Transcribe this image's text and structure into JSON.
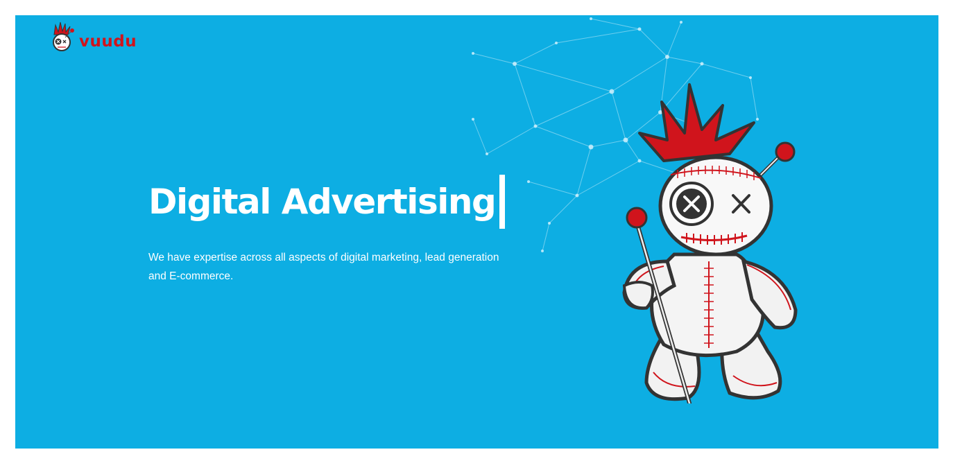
{
  "brand": {
    "name": "vuudu",
    "logo_icon": "voodoo-doll-head-icon",
    "accent_color": "#d0141c"
  },
  "hero": {
    "background_color": "#0daee3",
    "headline": "Digital Advertising",
    "description": "We have expertise across all aspects of digital marketing, lead generation and E-commerce.",
    "illustration": "voodoo-doll-with-pins-icon",
    "background_graphic": "network-constellation-icon"
  }
}
